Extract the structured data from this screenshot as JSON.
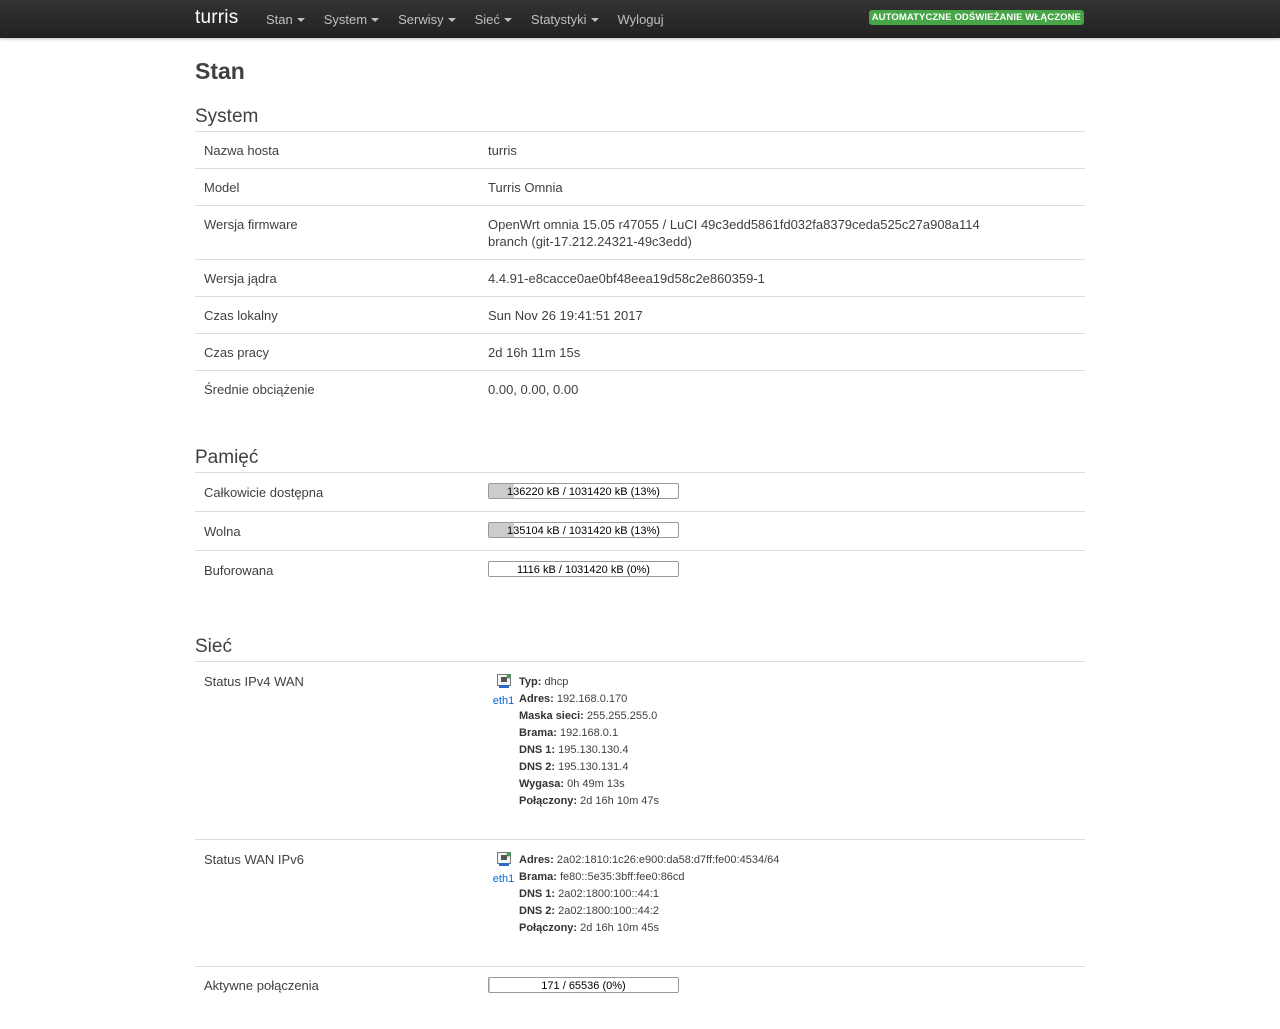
{
  "navbar": {
    "brand": "turris",
    "menu": [
      {
        "label": "Stan",
        "has_dropdown": true
      },
      {
        "label": "System",
        "has_dropdown": true
      },
      {
        "label": "Serwisy",
        "has_dropdown": true
      },
      {
        "label": "Sieć",
        "has_dropdown": true
      },
      {
        "label": "Statystyki",
        "has_dropdown": true
      },
      {
        "label": "Wyloguj",
        "has_dropdown": false
      }
    ],
    "refresh_badge": "AUTOMATYCZNE ODŚWIEŻANIE WŁĄCZONE",
    "badge_color": "#46a546"
  },
  "page": {
    "title": "Stan"
  },
  "system": {
    "heading": "System",
    "rows": [
      {
        "label": "Nazwa hosta",
        "value": "turris"
      },
      {
        "label": "Model",
        "value": "Turris Omnia"
      },
      {
        "label": "Wersja firmware",
        "value": "OpenWrt omnia 15.05 r47055 / LuCI 49c3edd5861fd032fa8379ceda525c27a908a114 branch (git-17.212.24321-49c3edd)"
      },
      {
        "label": "Wersja jądra",
        "value": "4.4.91-e8cacce0ae0bf48eea19d58c2e860359-1"
      },
      {
        "label": "Czas lokalny",
        "value": "Sun Nov 26 19:41:51 2017"
      },
      {
        "label": "Czas pracy",
        "value": "2d 16h 11m 15s"
      },
      {
        "label": "Średnie obciążenie",
        "value": "0.00, 0.00, 0.00"
      }
    ]
  },
  "memory": {
    "heading": "Pamięć",
    "rows": [
      {
        "label": "Całkowicie dostępna",
        "text": "136220 kB / 1031420 kB (13%)",
        "fraction": 0.13
      },
      {
        "label": "Wolna",
        "text": "135104 kB / 1031420 kB (13%)",
        "fraction": 0.13
      },
      {
        "label": "Buforowana",
        "text": "1116 kB / 1031420 kB (0%)",
        "fraction": 0.0
      }
    ]
  },
  "network": {
    "heading": "Sieć",
    "ipv4": {
      "label": "Status IPv4 WAN",
      "iface": "eth1",
      "icon": "ethernet-port-icon",
      "fields": [
        {
          "k": "Typ:",
          "v": "dhcp"
        },
        {
          "k": "Adres:",
          "v": "192.168.0.170"
        },
        {
          "k": "Maska sieci:",
          "v": "255.255.255.0"
        },
        {
          "k": "Brama:",
          "v": "192.168.0.1"
        },
        {
          "k": "DNS 1:",
          "v": "195.130.130.4"
        },
        {
          "k": "DNS 2:",
          "v": "195.130.131.4"
        },
        {
          "k": "Wygasa:",
          "v": "0h 49m 13s"
        },
        {
          "k": "Połączony:",
          "v": "2d 16h 10m 47s"
        }
      ]
    },
    "ipv6": {
      "label": "Status WAN IPv6",
      "iface": "eth1",
      "icon": "ethernet-port-icon",
      "fields": [
        {
          "k": "Adres:",
          "v": "2a02:1810:1c26:e900:da58:d7ff:fe00:4534/64"
        },
        {
          "k": "Brama:",
          "v": "fe80::5e35:3bff:fee0:86cd"
        },
        {
          "k": "DNS 1:",
          "v": "2a02:1800:100::44:1"
        },
        {
          "k": "DNS 2:",
          "v": "2a02:1800:100::44:2"
        },
        {
          "k": "Połączony:",
          "v": "2d 16h 10m 45s"
        }
      ]
    },
    "connections": {
      "label": "Aktywne połączenia",
      "text": "171 / 65536 (0%)",
      "fraction": 0.0026
    }
  }
}
